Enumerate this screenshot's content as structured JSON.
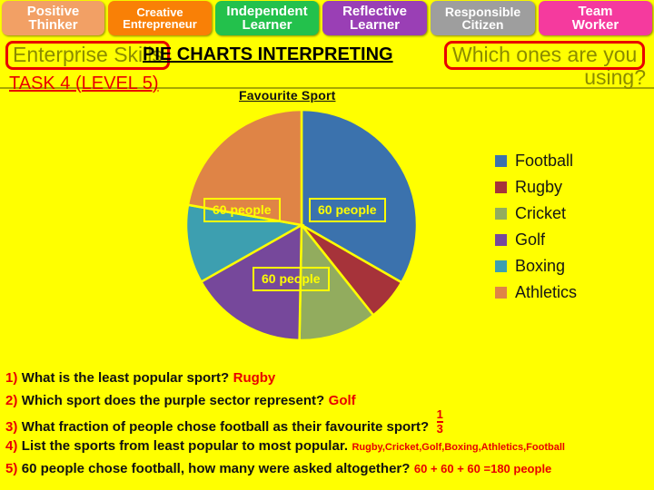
{
  "tabs": [
    {
      "line1": "Positive",
      "line2": "Thinker",
      "color": "#F2A065"
    },
    {
      "line1": "Creative",
      "line2": "Entrepreneur",
      "color": "#F98006"
    },
    {
      "line1": "Independent",
      "line2": "Learner",
      "color": "#23C14C"
    },
    {
      "line1": "Reflective",
      "line2": "Learner",
      "color": "#9A3FB5"
    },
    {
      "line1": "Responsible",
      "line2": "Citizen",
      "color": "#9E9E9E"
    },
    {
      "line1": "Team",
      "line2": "Worker",
      "color": "#F53A9E"
    }
  ],
  "header": {
    "enterprise_skills": "Enterprise Skills",
    "topic": "PIE CHARTS INTERPRETING",
    "which_ones": "Which ones are you",
    "using": "using?",
    "task": "TASK 4 (LEVEL 5)"
  },
  "chart_data": {
    "type": "pie",
    "title": "Favourite Sport",
    "categories": [
      "Football",
      "Rugby",
      "Cricket",
      "Golf",
      "Boxing",
      "Athletics"
    ],
    "values": [
      33.3,
      6.0,
      11.0,
      16.5,
      11.0,
      22.2
    ],
    "colors": [
      "#3B72AD",
      "#A6333A",
      "#92AC5E",
      "#76489B",
      "#3D9FB0",
      "#DF8446"
    ],
    "units": "percent of respondents",
    "legend_position": "right",
    "data_labels": [
      "60 people",
      "60 people",
      "60 people"
    ],
    "label_notes": [
      {
        "text": "60 people",
        "refers_to": "Athletics"
      },
      {
        "text": "60 people",
        "refers_to": "Football"
      },
      {
        "text": "60 people",
        "refers_to": "Golf"
      }
    ],
    "grid": false
  },
  "legend": [
    {
      "label": "Football",
      "color": "#3B72AD"
    },
    {
      "label": "Rugby",
      "color": "#A6333A"
    },
    {
      "label": "Cricket",
      "color": "#92AC5E"
    },
    {
      "label": "Golf",
      "color": "#76489B"
    },
    {
      "label": "Boxing",
      "color": "#3D9FB0"
    },
    {
      "label": "Athletics",
      "color": "#DF8446"
    }
  ],
  "questions": [
    {
      "num": "1)",
      "text": "What is the least popular sport?",
      "answer": "Rugby"
    },
    {
      "num": "2)",
      "text": "Which sport does the purple sector represent?",
      "answer": "Golf"
    },
    {
      "num": "3)",
      "text": "What fraction of people chose football as their favourite sport?",
      "answer_num": "1",
      "answer_den": "3"
    },
    {
      "num": "4)",
      "text": "List the sports from least popular to most popular.",
      "answer": "Rugby,Cricket,Golf,Boxing,Athletics,Football"
    },
    {
      "num": "5)",
      "text": "60 people chose football, how many were asked altogether?",
      "answer": "60 + 60 + 60 =180 people"
    }
  ]
}
